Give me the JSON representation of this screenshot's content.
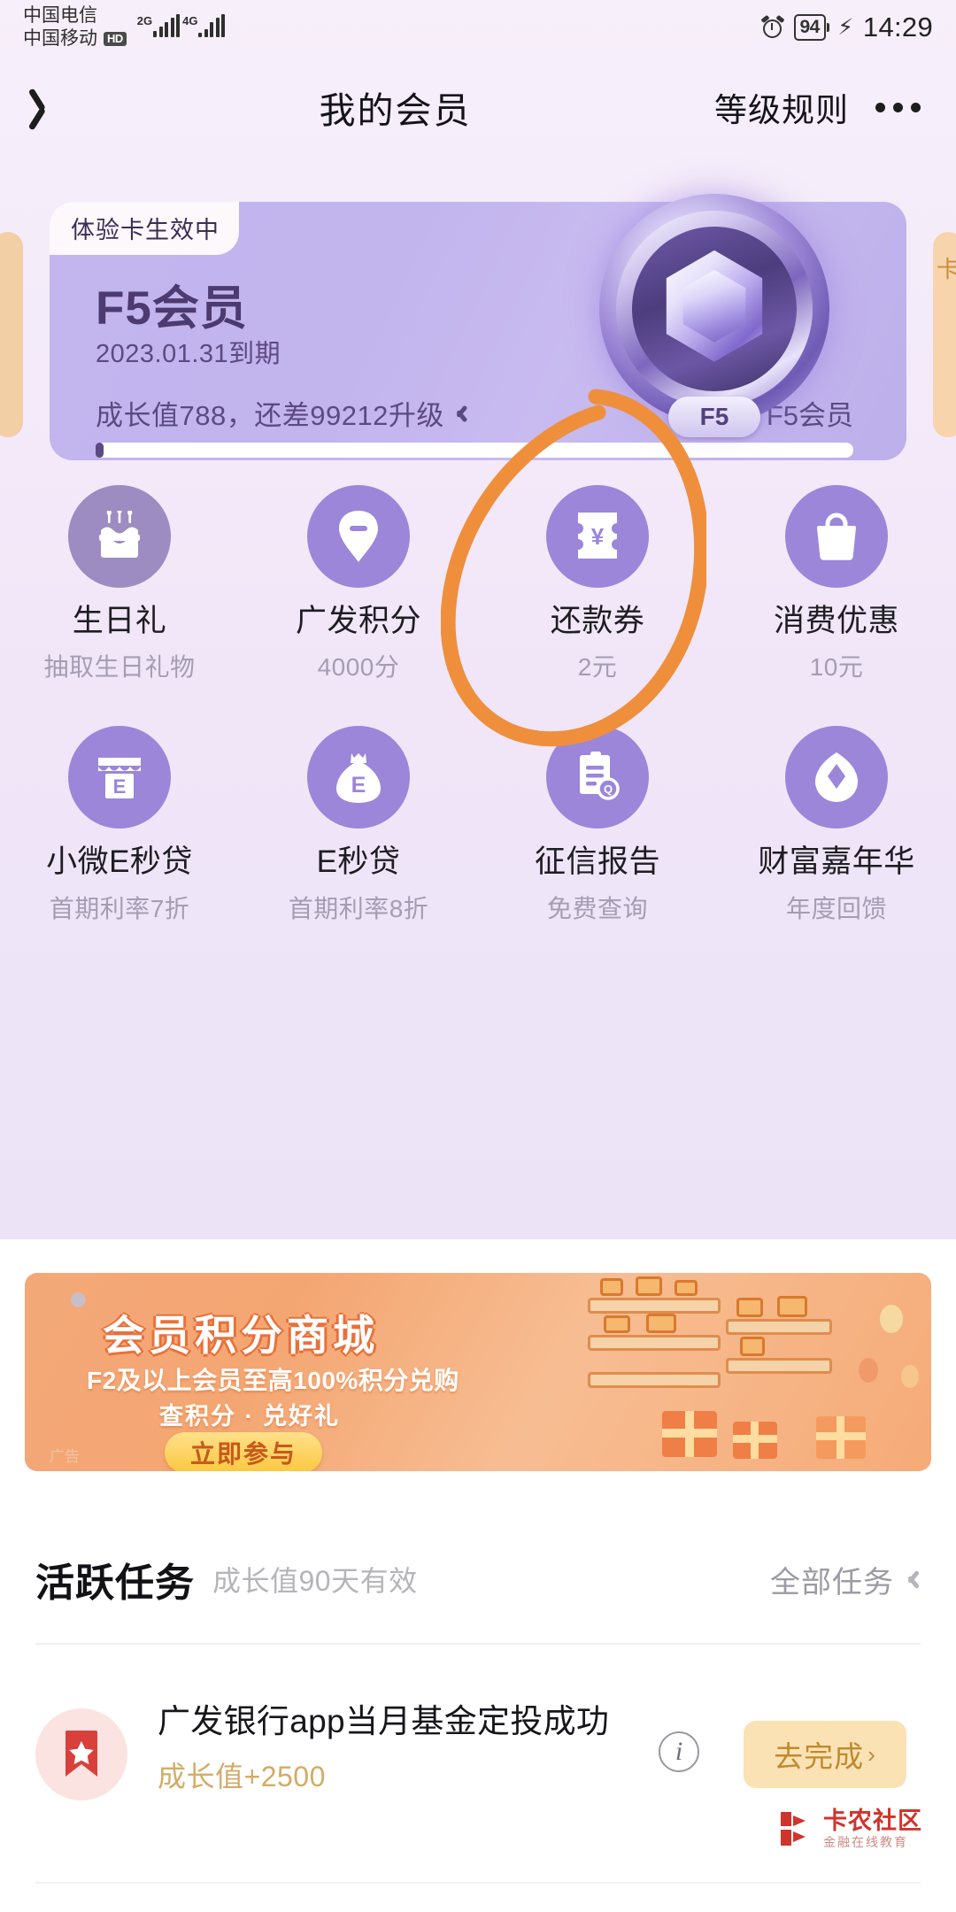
{
  "status_bar": {
    "carrier_1": "中国电信",
    "carrier_2": "中国移动",
    "hd_badge": "HD",
    "net_1": "2G",
    "net_2": "4G",
    "battery": "94",
    "time": "14:29"
  },
  "nav": {
    "back_icon": "chevron-left-icon",
    "title": "我的会员",
    "rule_label": "等级规则",
    "more_icon": "more-dots-icon"
  },
  "card": {
    "badge": "体验卡生效中",
    "level": "F5会员",
    "expire": "2023.01.31到期",
    "growth_text": "成长值788，还差99212升级",
    "growth_value": 788,
    "growth_needed": 99212,
    "level_right": "F5会员",
    "progress_percent": 1,
    "medal_label": "F5",
    "bg_color": "#c3b5ee",
    "accent_color": "#5b4a82"
  },
  "benefits": [
    {
      "icon": "birthday-cake-icon",
      "title": "生日礼",
      "sub": "抽取生日礼物",
      "dim": true
    },
    {
      "icon": "diamond-pin-icon",
      "title": "广发积分",
      "sub": "4000分",
      "dim": false
    },
    {
      "icon": "coupon-yuan-icon",
      "title": "还款券",
      "sub": "2元",
      "dim": false
    },
    {
      "icon": "shopping-bag-icon",
      "title": "消费优惠",
      "sub": "10元",
      "dim": false
    },
    {
      "icon": "storefront-e-icon",
      "title": "小微E秒贷",
      "sub": "首期利率7折",
      "dim": false
    },
    {
      "icon": "money-bag-e-icon",
      "title": "E秒贷",
      "sub": "首期利率8折",
      "dim": false
    },
    {
      "icon": "credit-report-icon",
      "title": "征信报告",
      "sub": "免费查询",
      "dim": false
    },
    {
      "icon": "gem-drop-icon",
      "title": "财富嘉年华",
      "sub": "年度回馈",
      "dim": false
    }
  ],
  "banner": {
    "title": "会员积分商城",
    "sub1": "F2及以上会员至高100%积分兑购",
    "sub2": "查积分 · 兑好礼",
    "button": "立即参与",
    "ad_mark": "广告",
    "bg_color": "#f3a878"
  },
  "tasks_section": {
    "title": "活跃任务",
    "subtitle": "成长值90天有效",
    "all_label": "全部任务",
    "chevron_icon": "chevron-right-icon"
  },
  "task": {
    "icon": "bookmark-star-icon",
    "title": "广发银行app当月基金定投成功",
    "reward": "成长值+2500",
    "info_icon": "info-circle-icon",
    "button": "去完成",
    "button_arrow": "›"
  },
  "watermark": {
    "main": "卡农社区",
    "sub": "金融在线教育"
  },
  "annotation": {
    "shape": "hand-drawn-ellipse",
    "color": "#ef8f3c",
    "target": "消费优惠"
  }
}
